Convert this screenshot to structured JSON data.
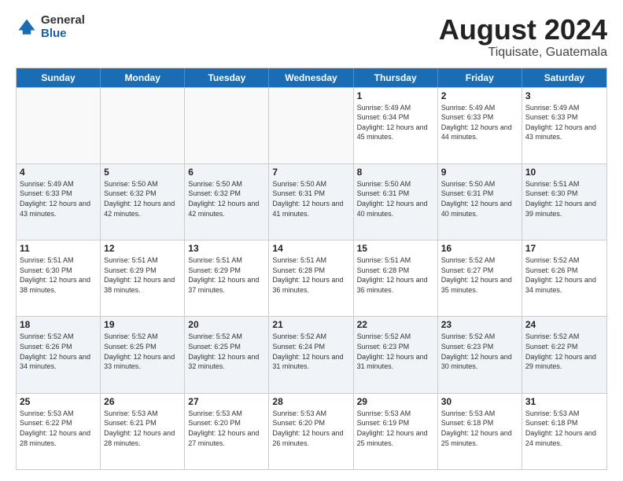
{
  "logo": {
    "general": "General",
    "blue": "Blue"
  },
  "title": "August 2024",
  "subtitle": "Tiquisate, Guatemala",
  "weekdays": [
    "Sunday",
    "Monday",
    "Tuesday",
    "Wednesday",
    "Thursday",
    "Friday",
    "Saturday"
  ],
  "weeks": [
    [
      {
        "day": "",
        "sunrise": "",
        "sunset": "",
        "daylight": "",
        "empty": true
      },
      {
        "day": "",
        "sunrise": "",
        "sunset": "",
        "daylight": "",
        "empty": true
      },
      {
        "day": "",
        "sunrise": "",
        "sunset": "",
        "daylight": "",
        "empty": true
      },
      {
        "day": "",
        "sunrise": "",
        "sunset": "",
        "daylight": "",
        "empty": true
      },
      {
        "day": "1",
        "sunrise": "Sunrise: 5:49 AM",
        "sunset": "Sunset: 6:34 PM",
        "daylight": "Daylight: 12 hours and 45 minutes."
      },
      {
        "day": "2",
        "sunrise": "Sunrise: 5:49 AM",
        "sunset": "Sunset: 6:33 PM",
        "daylight": "Daylight: 12 hours and 44 minutes."
      },
      {
        "day": "3",
        "sunrise": "Sunrise: 5:49 AM",
        "sunset": "Sunset: 6:33 PM",
        "daylight": "Daylight: 12 hours and 43 minutes."
      }
    ],
    [
      {
        "day": "4",
        "sunrise": "Sunrise: 5:49 AM",
        "sunset": "Sunset: 6:33 PM",
        "daylight": "Daylight: 12 hours and 43 minutes."
      },
      {
        "day": "5",
        "sunrise": "Sunrise: 5:50 AM",
        "sunset": "Sunset: 6:32 PM",
        "daylight": "Daylight: 12 hours and 42 minutes."
      },
      {
        "day": "6",
        "sunrise": "Sunrise: 5:50 AM",
        "sunset": "Sunset: 6:32 PM",
        "daylight": "Daylight: 12 hours and 42 minutes."
      },
      {
        "day": "7",
        "sunrise": "Sunrise: 5:50 AM",
        "sunset": "Sunset: 6:31 PM",
        "daylight": "Daylight: 12 hours and 41 minutes."
      },
      {
        "day": "8",
        "sunrise": "Sunrise: 5:50 AM",
        "sunset": "Sunset: 6:31 PM",
        "daylight": "Daylight: 12 hours and 40 minutes."
      },
      {
        "day": "9",
        "sunrise": "Sunrise: 5:50 AM",
        "sunset": "Sunset: 6:31 PM",
        "daylight": "Daylight: 12 hours and 40 minutes."
      },
      {
        "day": "10",
        "sunrise": "Sunrise: 5:51 AM",
        "sunset": "Sunset: 6:30 PM",
        "daylight": "Daylight: 12 hours and 39 minutes."
      }
    ],
    [
      {
        "day": "11",
        "sunrise": "Sunrise: 5:51 AM",
        "sunset": "Sunset: 6:30 PM",
        "daylight": "Daylight: 12 hours and 38 minutes."
      },
      {
        "day": "12",
        "sunrise": "Sunrise: 5:51 AM",
        "sunset": "Sunset: 6:29 PM",
        "daylight": "Daylight: 12 hours and 38 minutes."
      },
      {
        "day": "13",
        "sunrise": "Sunrise: 5:51 AM",
        "sunset": "Sunset: 6:29 PM",
        "daylight": "Daylight: 12 hours and 37 minutes."
      },
      {
        "day": "14",
        "sunrise": "Sunrise: 5:51 AM",
        "sunset": "Sunset: 6:28 PM",
        "daylight": "Daylight: 12 hours and 36 minutes."
      },
      {
        "day": "15",
        "sunrise": "Sunrise: 5:51 AM",
        "sunset": "Sunset: 6:28 PM",
        "daylight": "Daylight: 12 hours and 36 minutes."
      },
      {
        "day": "16",
        "sunrise": "Sunrise: 5:52 AM",
        "sunset": "Sunset: 6:27 PM",
        "daylight": "Daylight: 12 hours and 35 minutes."
      },
      {
        "day": "17",
        "sunrise": "Sunrise: 5:52 AM",
        "sunset": "Sunset: 6:26 PM",
        "daylight": "Daylight: 12 hours and 34 minutes."
      }
    ],
    [
      {
        "day": "18",
        "sunrise": "Sunrise: 5:52 AM",
        "sunset": "Sunset: 6:26 PM",
        "daylight": "Daylight: 12 hours and 34 minutes."
      },
      {
        "day": "19",
        "sunrise": "Sunrise: 5:52 AM",
        "sunset": "Sunset: 6:25 PM",
        "daylight": "Daylight: 12 hours and 33 minutes."
      },
      {
        "day": "20",
        "sunrise": "Sunrise: 5:52 AM",
        "sunset": "Sunset: 6:25 PM",
        "daylight": "Daylight: 12 hours and 32 minutes."
      },
      {
        "day": "21",
        "sunrise": "Sunrise: 5:52 AM",
        "sunset": "Sunset: 6:24 PM",
        "daylight": "Daylight: 12 hours and 31 minutes."
      },
      {
        "day": "22",
        "sunrise": "Sunrise: 5:52 AM",
        "sunset": "Sunset: 6:23 PM",
        "daylight": "Daylight: 12 hours and 31 minutes."
      },
      {
        "day": "23",
        "sunrise": "Sunrise: 5:52 AM",
        "sunset": "Sunset: 6:23 PM",
        "daylight": "Daylight: 12 hours and 30 minutes."
      },
      {
        "day": "24",
        "sunrise": "Sunrise: 5:52 AM",
        "sunset": "Sunset: 6:22 PM",
        "daylight": "Daylight: 12 hours and 29 minutes."
      }
    ],
    [
      {
        "day": "25",
        "sunrise": "Sunrise: 5:53 AM",
        "sunset": "Sunset: 6:22 PM",
        "daylight": "Daylight: 12 hours and 28 minutes."
      },
      {
        "day": "26",
        "sunrise": "Sunrise: 5:53 AM",
        "sunset": "Sunset: 6:21 PM",
        "daylight": "Daylight: 12 hours and 28 minutes."
      },
      {
        "day": "27",
        "sunrise": "Sunrise: 5:53 AM",
        "sunset": "Sunset: 6:20 PM",
        "daylight": "Daylight: 12 hours and 27 minutes."
      },
      {
        "day": "28",
        "sunrise": "Sunrise: 5:53 AM",
        "sunset": "Sunset: 6:20 PM",
        "daylight": "Daylight: 12 hours and 26 minutes."
      },
      {
        "day": "29",
        "sunrise": "Sunrise: 5:53 AM",
        "sunset": "Sunset: 6:19 PM",
        "daylight": "Daylight: 12 hours and 25 minutes."
      },
      {
        "day": "30",
        "sunrise": "Sunrise: 5:53 AM",
        "sunset": "Sunset: 6:18 PM",
        "daylight": "Daylight: 12 hours and 25 minutes."
      },
      {
        "day": "31",
        "sunrise": "Sunrise: 5:53 AM",
        "sunset": "Sunset: 6:18 PM",
        "daylight": "Daylight: 12 hours and 24 minutes."
      }
    ]
  ]
}
